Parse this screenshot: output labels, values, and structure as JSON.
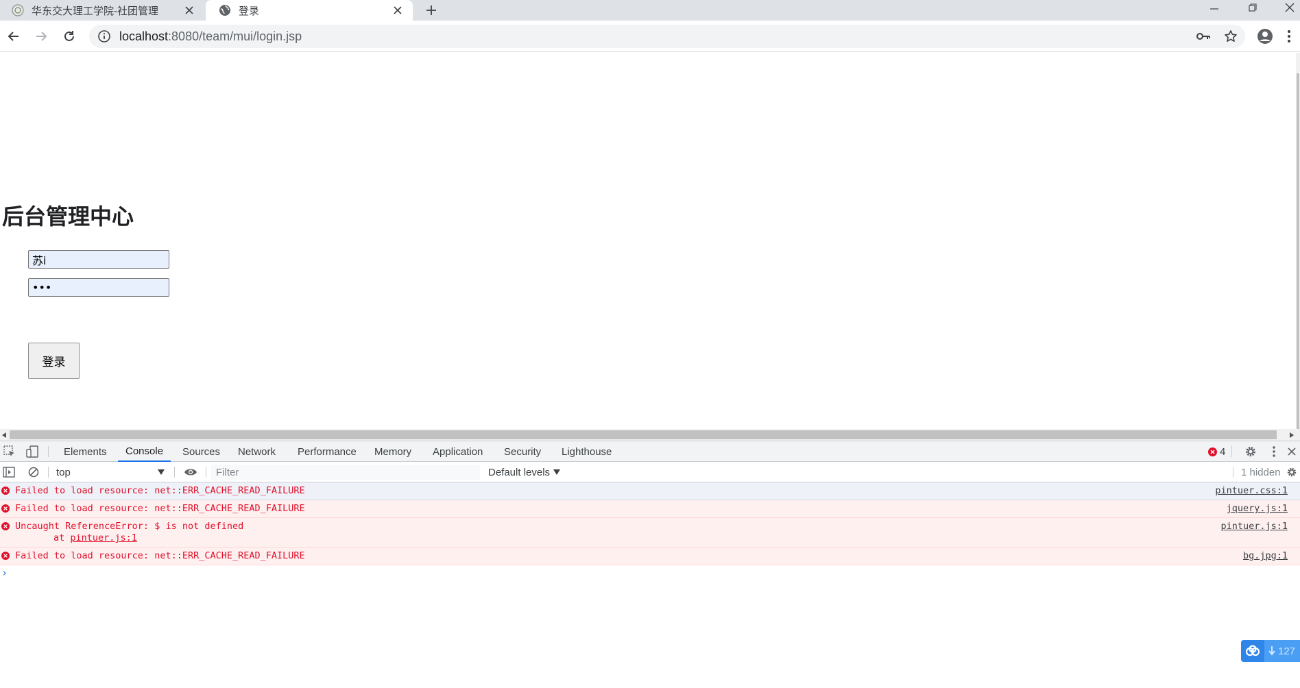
{
  "browser": {
    "tabs": [
      {
        "title": "华东交大理工学院-社团管理",
        "active": false
      },
      {
        "title": "登录",
        "active": true
      }
    ],
    "url_host": "localhost",
    "url_path": ":8080/team/mui/login.jsp"
  },
  "page": {
    "heading": "后台管理中心",
    "username_value": "苏i",
    "password_value": "•••",
    "login_button": "登录"
  },
  "devtools": {
    "tabs": [
      "Elements",
      "Console",
      "Sources",
      "Network",
      "Performance",
      "Memory",
      "Application",
      "Security",
      "Lighthouse"
    ],
    "active_tab": "Console",
    "error_count": "4",
    "context": "top",
    "filter_placeholder": "Filter",
    "levels": "Default levels",
    "hidden": "1 hidden",
    "messages": [
      {
        "text": "Failed to load resource: net::ERR_CACHE_READ_FAILURE",
        "source": "pintuer.css:1"
      },
      {
        "text": "Failed to load resource: net::ERR_CACHE_READ_FAILURE",
        "source": "jquery.js:1"
      },
      {
        "text": "Uncaught ReferenceError: $ is not defined",
        "sub_prefix": "at ",
        "sub_link": "pintuer.js:1",
        "source": "pintuer.js:1"
      },
      {
        "text": "Failed to load resource: net::ERR_CACHE_READ_FAILURE",
        "source": "bg.jpg:1"
      }
    ],
    "prompt": "›"
  },
  "badge": {
    "count": "127"
  },
  "colors": {
    "accent": "#1a73e8",
    "error": "#e0102b",
    "error_bg": "#fff0f0"
  }
}
